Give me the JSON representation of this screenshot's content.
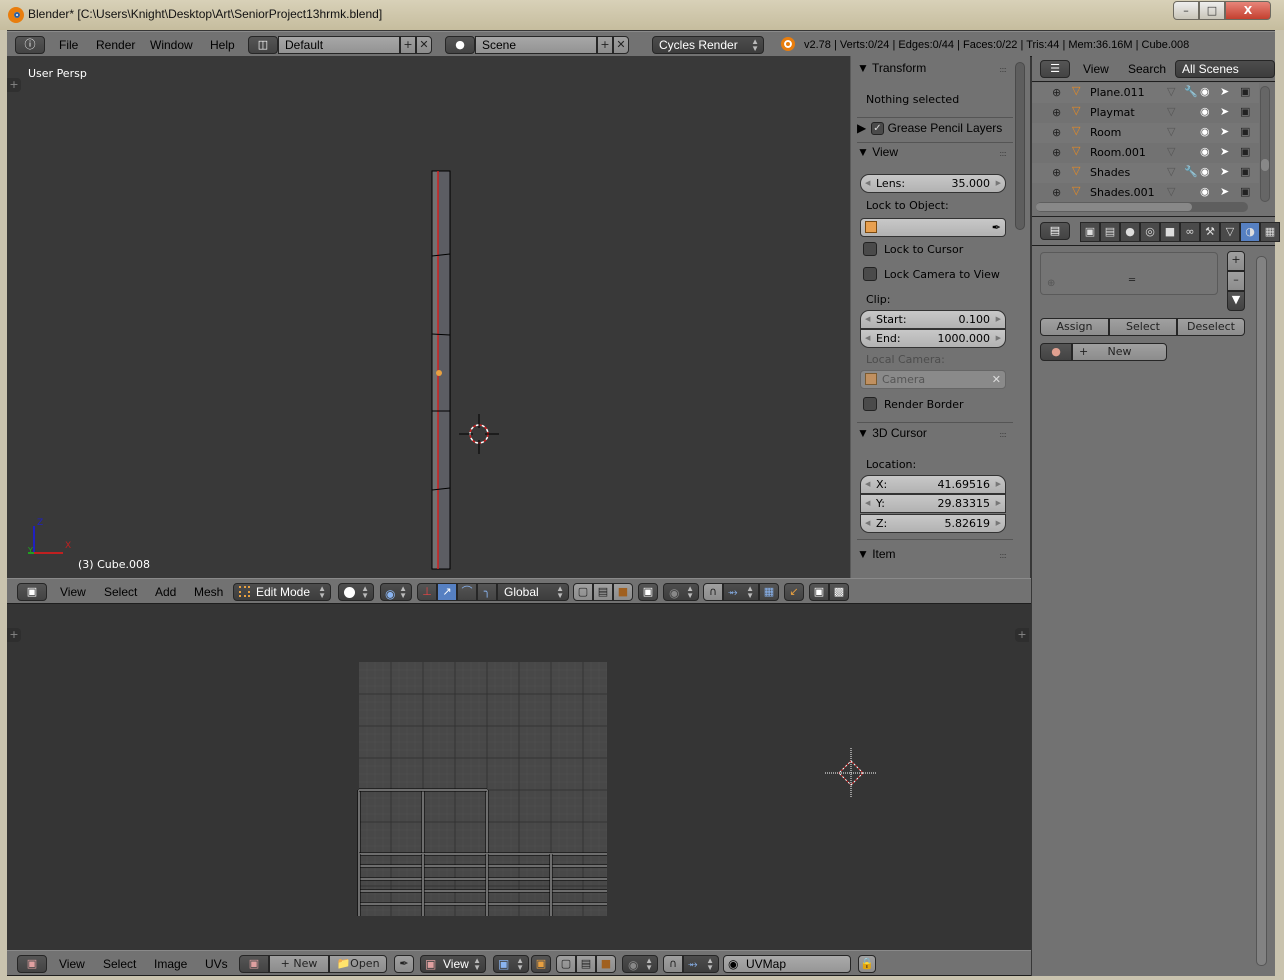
{
  "window": {
    "title": "Blender* [C:\\Users\\Knight\\Desktop\\Art\\SeniorProject13hrmk.blend]",
    "controls": {
      "minimize": "–",
      "maximize": "□",
      "close": "X"
    }
  },
  "info_header": {
    "menus": [
      "File",
      "Render",
      "Window",
      "Help"
    ],
    "layout": "Default",
    "scene": "Scene",
    "engine": "Cycles Render",
    "stats": "v2.78 | Verts:0/24 | Edges:0/44 | Faces:0/22 | Tris:44 | Mem:36.16M | Cube.008"
  },
  "viewport": {
    "view_label": "User Persp",
    "object_label": "(3) Cube.008",
    "axes": {
      "x": "X",
      "y": "Y",
      "z": "Z"
    }
  },
  "n_panel": {
    "transform": {
      "title": "Transform",
      "empty_text": "Nothing selected"
    },
    "grease_pencil": {
      "title": "Grease Pencil Layers",
      "checked": true
    },
    "view": {
      "title": "View",
      "lens_label": "Lens:",
      "lens_value": "35.000",
      "lock_to_object_label": "Lock to Object:",
      "lock_to_cursor": "Lock to Cursor",
      "lock_camera_to_view": "Lock Camera to View",
      "clip_label": "Clip:",
      "clip_start_label": "Start:",
      "clip_start": "0.100",
      "clip_end_label": "End:",
      "clip_end": "1000.000",
      "local_camera_label": "Local Camera:",
      "local_camera_value": "Camera",
      "render_border": "Render Border"
    },
    "cursor": {
      "title": "3D Cursor",
      "location_label": "Location:",
      "x_label": "X:",
      "x": "41.69516",
      "y_label": "Y:",
      "y": "29.83315",
      "z_label": "Z:",
      "z": "5.82619"
    },
    "item": {
      "title": "Item"
    }
  },
  "view3d_header": {
    "menus": [
      "View",
      "Select",
      "Add",
      "Mesh"
    ],
    "mode": "Edit Mode",
    "orientation": "Global"
  },
  "outliner": {
    "menus": [
      "View",
      "Search"
    ],
    "filter": "All Scenes",
    "items": [
      {
        "name": "Plane.011",
        "modifier": true
      },
      {
        "name": "Playmat",
        "modifier": false
      },
      {
        "name": "Room",
        "modifier": false
      },
      {
        "name": "Room.001",
        "modifier": false
      },
      {
        "name": "Shades",
        "modifier": true
      },
      {
        "name": "Shades.001",
        "modifier": false
      }
    ]
  },
  "properties": {
    "tabs": [
      "render",
      "render-layers",
      "scene",
      "world",
      "object",
      "constraints",
      "modifiers",
      "data",
      "material",
      "texture"
    ],
    "active_tab": "material",
    "buttons": {
      "assign": "Assign",
      "select": "Select",
      "deselect": "Deselect",
      "new": "New"
    }
  },
  "uv_header": {
    "menus": [
      "View",
      "Select",
      "Image",
      "UVs"
    ],
    "new_label": "New",
    "open_label": "Open",
    "view_label": "View",
    "uvmap": "UVMap"
  }
}
